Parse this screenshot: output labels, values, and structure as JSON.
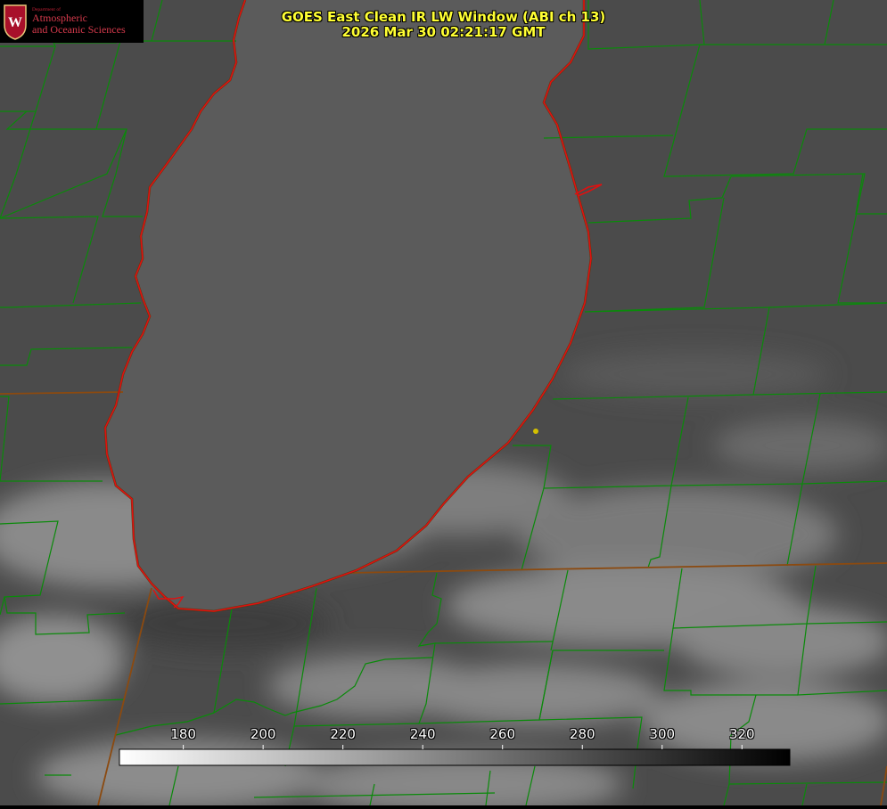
{
  "header": {
    "title_line1": "GOES East Clean IR LW Window (ABI ch 13)",
    "title_line2": "2026 Mar 30 02:21:17 GMT"
  },
  "logo": {
    "department": "Department of",
    "line1": "Atmospheric",
    "line2": "and Oceanic Sciences",
    "crest_letter": "W"
  },
  "colorbar": {
    "tick_labels": [
      "180",
      "200",
      "220",
      "240",
      "260",
      "280",
      "300",
      "320"
    ],
    "tick_values": [
      180,
      200,
      220,
      240,
      260,
      280,
      300,
      320
    ],
    "scale_min": 164,
    "scale_max": 332,
    "gradient": [
      "#ffffff",
      "#000000"
    ]
  },
  "colors": {
    "title": "#ffff33",
    "county_lines": "#0a8a0a",
    "shoreline": "#e01010",
    "state_line": "#8b4a10",
    "marker": "#d4c000",
    "land": "#4a4a4a",
    "lake": "#5b5b5b"
  }
}
